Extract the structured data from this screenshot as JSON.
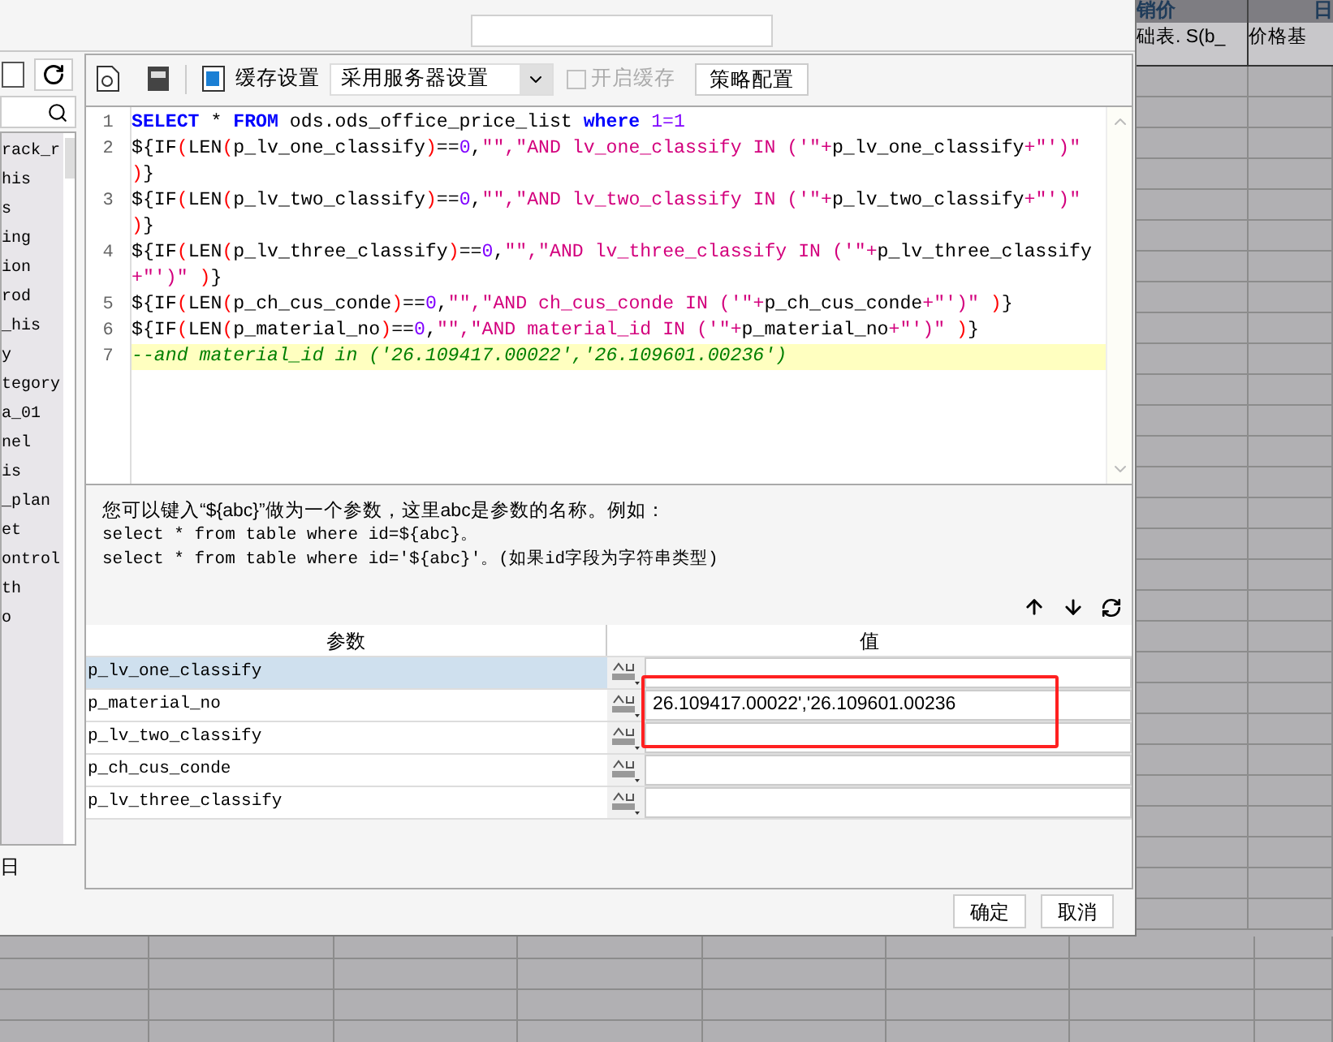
{
  "sheet": {
    "header": [
      "销价",
      "日"
    ],
    "cells": [
      "础表. S(b_",
      "价格基"
    ]
  },
  "sidebar": {
    "items": [
      "rack_r",
      "his",
      "s",
      "ing",
      "ion",
      "rod",
      "_his",
      "y",
      "tegory",
      "a_01",
      "nel",
      "is",
      "_plan",
      "et",
      "ontrol",
      "th",
      "o"
    ],
    "footer": "日"
  },
  "toolbar": {
    "cache_label": "缓存设置",
    "cache_select": "采用服务器设置",
    "cache_checkbox": {
      "label": "开启缓存",
      "checked": false,
      "disabled": true
    },
    "strategy_button": "策略配置"
  },
  "editor": {
    "lines": [
      {
        "number": "1",
        "current": false,
        "tokens": [
          {
            "kind": "kw",
            "text": "SELECT"
          },
          {
            "kind": "plain",
            "text": " * "
          },
          {
            "kind": "kw",
            "text": "FROM"
          },
          {
            "kind": "plain",
            "text": " ods.ods_office_price_list "
          },
          {
            "kind": "kw",
            "text": "where"
          },
          {
            "kind": "num",
            "text": " 1=1"
          }
        ]
      },
      {
        "number": "2",
        "current": false,
        "tokens": [
          {
            "kind": "plain",
            "text": "${IF"
          },
          {
            "kind": "paren",
            "text": "("
          },
          {
            "kind": "plain",
            "text": "LEN"
          },
          {
            "kind": "paren",
            "text": "("
          },
          {
            "kind": "plain",
            "text": "p_lv_one_classify"
          },
          {
            "kind": "paren",
            "text": ")"
          },
          {
            "kind": "plain",
            "text": "=="
          },
          {
            "kind": "num",
            "text": "0"
          },
          {
            "kind": "plain",
            "text": ","
          },
          {
            "kind": "str",
            "text": "\"\",\"AND lv_one_classify IN ('\"+"
          },
          {
            "kind": "plain",
            "text": "p_lv_one_classify"
          },
          {
            "kind": "str",
            "text": "+\"')\""
          }
        ]
      },
      {
        "current": false,
        "tokens": [
          {
            "kind": "paren",
            "text": ")"
          },
          {
            "kind": "plain",
            "text": "}"
          }
        ]
      },
      {
        "number": "3",
        "current": false,
        "tokens": [
          {
            "kind": "plain",
            "text": "${IF"
          },
          {
            "kind": "paren",
            "text": "("
          },
          {
            "kind": "plain",
            "text": "LEN"
          },
          {
            "kind": "paren",
            "text": "("
          },
          {
            "kind": "plain",
            "text": "p_lv_two_classify"
          },
          {
            "kind": "paren",
            "text": ")"
          },
          {
            "kind": "plain",
            "text": "=="
          },
          {
            "kind": "num",
            "text": "0"
          },
          {
            "kind": "plain",
            "text": ","
          },
          {
            "kind": "str",
            "text": "\"\",\"AND lv_two_classify IN ('\"+"
          },
          {
            "kind": "plain",
            "text": "p_lv_two_classify"
          },
          {
            "kind": "str",
            "text": "+\"')\""
          }
        ]
      },
      {
        "current": false,
        "tokens": [
          {
            "kind": "paren",
            "text": ")"
          },
          {
            "kind": "plain",
            "text": "}"
          }
        ]
      },
      {
        "number": "4",
        "current": false,
        "tokens": [
          {
            "kind": "plain",
            "text": "${IF"
          },
          {
            "kind": "paren",
            "text": "("
          },
          {
            "kind": "plain",
            "text": "LEN"
          },
          {
            "kind": "paren",
            "text": "("
          },
          {
            "kind": "plain",
            "text": "p_lv_three_classify"
          },
          {
            "kind": "paren",
            "text": ")"
          },
          {
            "kind": "plain",
            "text": "=="
          },
          {
            "kind": "num",
            "text": "0"
          },
          {
            "kind": "plain",
            "text": ","
          },
          {
            "kind": "str",
            "text": "\"\",\"AND lv_three_classify IN ('\"+"
          },
          {
            "kind": "plain",
            "text": "p_lv_three_classify"
          }
        ]
      },
      {
        "current": false,
        "tokens": [
          {
            "kind": "str",
            "text": "+\"')\" "
          },
          {
            "kind": "paren",
            "text": ")"
          },
          {
            "kind": "plain",
            "text": "}"
          }
        ]
      },
      {
        "number": "5",
        "current": false,
        "tokens": [
          {
            "kind": "plain",
            "text": "${IF"
          },
          {
            "kind": "paren",
            "text": "("
          },
          {
            "kind": "plain",
            "text": "LEN"
          },
          {
            "kind": "paren",
            "text": "("
          },
          {
            "kind": "plain",
            "text": "p_ch_cus_conde"
          },
          {
            "kind": "paren",
            "text": ")"
          },
          {
            "kind": "plain",
            "text": "=="
          },
          {
            "kind": "num",
            "text": "0"
          },
          {
            "kind": "plain",
            "text": ","
          },
          {
            "kind": "str",
            "text": "\"\",\"AND ch_cus_conde IN ('\"+"
          },
          {
            "kind": "plain",
            "text": "p_ch_cus_conde"
          },
          {
            "kind": "str",
            "text": "+\"')\" "
          },
          {
            "kind": "paren",
            "text": ")"
          },
          {
            "kind": "plain",
            "text": "}"
          }
        ]
      },
      {
        "number": "6",
        "current": false,
        "tokens": [
          {
            "kind": "plain",
            "text": "${IF"
          },
          {
            "kind": "paren",
            "text": "("
          },
          {
            "kind": "plain",
            "text": "LEN"
          },
          {
            "kind": "paren",
            "text": "("
          },
          {
            "kind": "plain",
            "text": "p_material_no"
          },
          {
            "kind": "paren",
            "text": ")"
          },
          {
            "kind": "plain",
            "text": "=="
          },
          {
            "kind": "num",
            "text": "0"
          },
          {
            "kind": "plain",
            "text": ","
          },
          {
            "kind": "str",
            "text": "\"\",\"AND material_id IN ('\"+"
          },
          {
            "kind": "plain",
            "text": "p_material_no"
          },
          {
            "kind": "str",
            "text": "+\"')\" "
          },
          {
            "kind": "paren",
            "text": ")"
          },
          {
            "kind": "plain",
            "text": "}"
          }
        ]
      },
      {
        "number": "7",
        "current": true,
        "tokens": [
          {
            "kind": "comment",
            "text": "--and material_id in ('26.109417.00022','26.109601.00236')"
          }
        ]
      }
    ]
  },
  "help": {
    "intro": "您可以键入“${abc}”做为一个参数，这里abc是参数的名称。例如：",
    "examples": [
      "select * from table where id=${abc}。",
      "select * from table where id='${abc}'。(如果id字段为字符串类型)"
    ]
  },
  "params": {
    "columns": [
      "参数",
      "值"
    ],
    "rows": [
      {
        "name": "p_lv_one_classify",
        "selected": true
      },
      {
        "name": "p_material_no",
        "value": "26.109417.00022','26.109601.00236",
        "selected": false
      },
      {
        "name": "p_lv_two_classify",
        "selected": false
      },
      {
        "name": "p_ch_cus_conde",
        "selected": false
      },
      {
        "name": "p_lv_three_classify",
        "selected": false
      }
    ]
  },
  "buttons": [
    "确定",
    "取消"
  ]
}
